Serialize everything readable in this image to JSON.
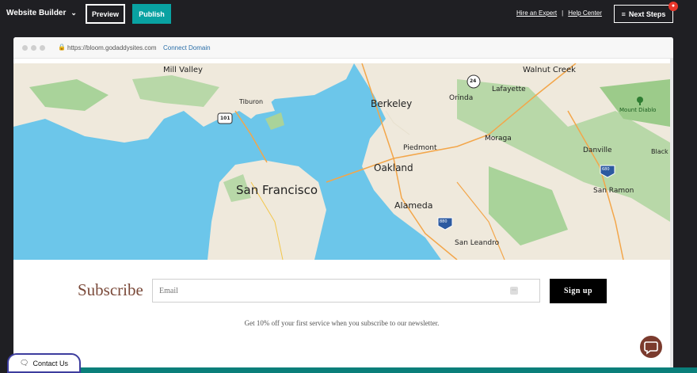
{
  "topbar": {
    "brand": "Website Builder",
    "preview_label": "Preview",
    "publish_label": "Publish",
    "hire_label": "Hire an Expert",
    "separator": "|",
    "help_label": "Help Center",
    "next_steps_label": "Next Steps"
  },
  "browser": {
    "url": "https://bloom.godaddysites.com",
    "connect_label": "Connect Domain"
  },
  "map": {
    "labels": {
      "mill_valley": "Mill Valley",
      "tiburon": "Tiburon",
      "berkeley": "Berkeley",
      "orinda": "Orinda",
      "lafayette": "Lafayette",
      "walnut_creek": "Walnut Creek",
      "mount_diablo": "Mount Diablo",
      "piedmont": "Piedmont",
      "moraga": "Moraga",
      "danville": "Danville",
      "black": "Black",
      "oakland": "Oakland",
      "san_francisco": "San Francisco",
      "alameda": "Alameda",
      "san_ramon": "San Ramon",
      "san_leandro": "San Leandro"
    },
    "shields": {
      "us101": "101",
      "ca24": "24",
      "i680": "680",
      "i880": "880"
    }
  },
  "subscribe": {
    "title": "Subscribe",
    "email_placeholder": "Email",
    "signup_label": "Sign up",
    "offer_text": "Get 10% off your first service when you subscribe to our newsletter."
  },
  "contact": {
    "label": "Contact Us"
  },
  "colors": {
    "accent_teal": "#09a2a2",
    "subscribe_brown": "#7b4a3a",
    "chat_bubble": "#7b3b2e",
    "water": "#6cc6ea"
  }
}
